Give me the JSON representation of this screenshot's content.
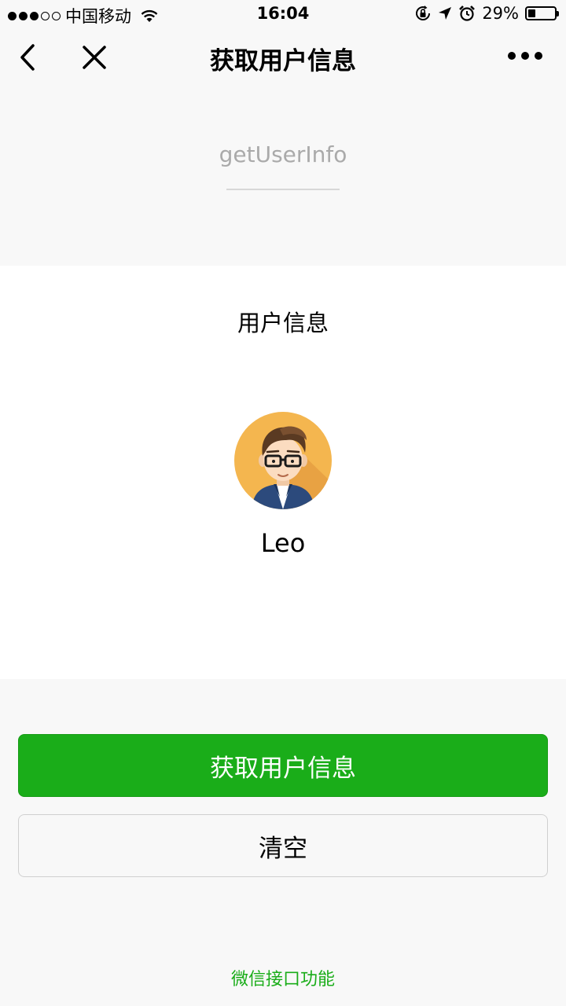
{
  "status_bar": {
    "carrier": "中国移动",
    "time": "16:04",
    "battery_percent_label": "29%",
    "battery_level": 0.29,
    "signal_strength": 3,
    "signal_max": 5
  },
  "nav": {
    "title": "获取用户信息"
  },
  "api": {
    "name": "getUserInfo"
  },
  "user_info": {
    "title": "用户信息",
    "nickname": "Leo"
  },
  "buttons": {
    "get_user_info": "获取用户信息",
    "clear": "清空"
  },
  "footer": {
    "text": "微信接口功能"
  },
  "colors": {
    "primary": "#1aad19",
    "avatar_bg": "#f4b64f"
  }
}
